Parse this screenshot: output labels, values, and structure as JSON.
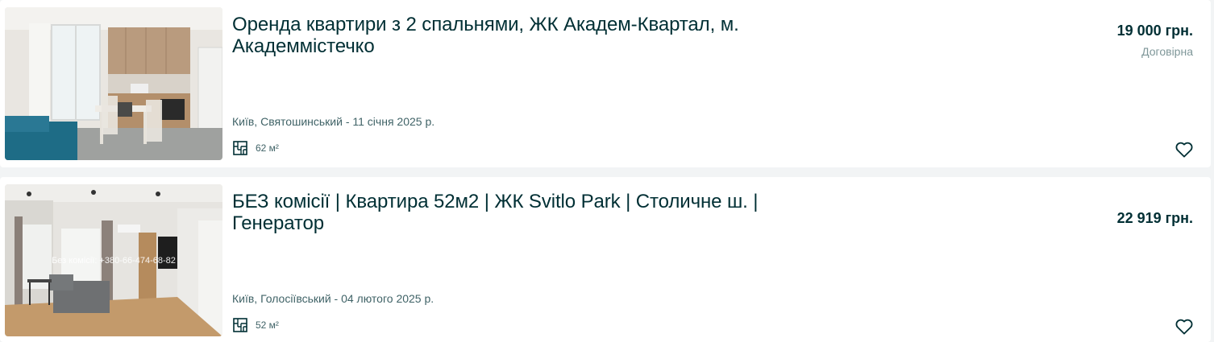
{
  "listings": [
    {
      "title": "Оренда квартири з 2 спальнями, ЖК Академ-Квартал, м. Академмістечко",
      "location_date": "Київ, Святошинський - 11 січня 2025 р.",
      "area": "62 м²",
      "price": "19 000 грн.",
      "negotiable": "Договірна",
      "photo_watermark": ""
    },
    {
      "title": "БЕЗ комісії | Квартира 52м2 | ЖК Svitlo Park | Столичне ш. | Генератор",
      "location_date": "Київ, Голосіївський - 04 лютого 2025 р.",
      "area": "52 м²",
      "price": "22 919 грн.",
      "photo_watermark": "Без комісії: +380-66-474-68-82"
    }
  ],
  "icons": {
    "area": "floor-plan-icon",
    "favorite": "heart-outline-icon"
  },
  "colors": {
    "text_primary": "#002f34",
    "text_secondary": "#406367",
    "text_muted": "#7f9799",
    "page_background": "#f2f4f5",
    "card_background": "#ffffff"
  }
}
